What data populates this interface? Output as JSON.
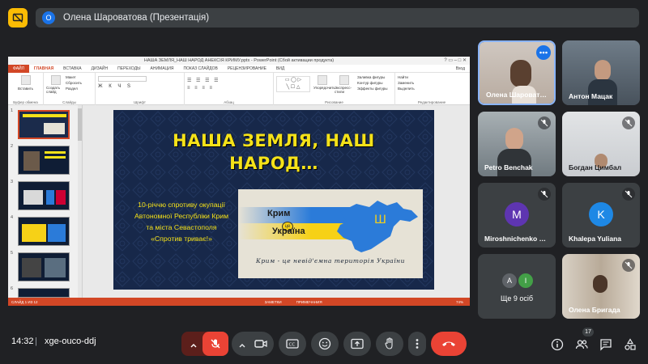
{
  "topbar": {
    "presenter_avatar": "O",
    "presenter_label": "Олена Шароватова (Презентація)"
  },
  "ppt": {
    "window_title": "НАША ЗЕМЛЯ_НАШ НАРОД АНЕКСІЯ КРИМУ.pptx - PowerPoint (Сбой активации продукта)",
    "menu": [
      "ФАЙЛ",
      "ГЛАВНАЯ",
      "ВСТАВКА",
      "ДИЗАЙН",
      "ПЕРЕХОДЫ",
      "АНИМАЦИЯ",
      "ПОКАЗ СЛАЙДОВ",
      "РЕЦЕНЗИРОВАНИЕ",
      "ВИД"
    ],
    "signin": "Вход",
    "ribbon": {
      "clipboard": {
        "name": "Буфер обмена",
        "paste": "Вставить"
      },
      "slides": {
        "name": "Слайды",
        "new_slide": "Создать слайд",
        "layout": "Макет",
        "reset": "Сбросить",
        "section": "Раздел"
      },
      "font": {
        "name": "Шрифт"
      },
      "paragraph": {
        "name": "Абзац"
      },
      "drawing": {
        "name": "Рисование",
        "arrange": "Упорядочить",
        "quick_styles": "Экспресс-стили",
        "fill": "Заливка фигуры",
        "outline": "Контур фигуры",
        "effects": "Эффекты фигуры"
      },
      "editing": {
        "name": "Редактирование",
        "find": "Найти",
        "replace": "Заменить",
        "select": "Выделить"
      }
    },
    "thumb_numbers": [
      "1",
      "2",
      "3",
      "4",
      "5",
      "6"
    ],
    "slide": {
      "title_line1": "НАША ЗЕМЛЯ, НАШ",
      "title_line2": "НАРОД…",
      "body": "10-річчю спротиву окупації Автономної Республіки Крим та міста Севастополя «Спротив триває!»",
      "card_word1": "Крим",
      "card_word2": "це",
      "card_word3": "Україна",
      "card_caption": "Крим - це невід'ємна територія України"
    },
    "status": {
      "slide_info": "СЛАЙД 1 ИЗ 12",
      "notes": "ЗАМЕТКИ",
      "comments": "ПРИМЕЧАНИЯ",
      "zoom": "74%"
    }
  },
  "participants": [
    {
      "name": "Олена Шароватова",
      "short": "Олена Шароват…",
      "muted": false,
      "video": true
    },
    {
      "name": "Антон Мацак",
      "muted": false,
      "video": true
    },
    {
      "name": "Petro Benchak",
      "muted": true,
      "video": true
    },
    {
      "name": "Богдан Цимбал",
      "muted": true,
      "video": true
    },
    {
      "name": "Miroshnichenko …",
      "initial": "M",
      "muted": true,
      "video": false,
      "color": "#5e35b1"
    },
    {
      "name": "Khalepa Yuliana",
      "initial": "K",
      "muted": true,
      "video": false,
      "color": "#1e88e5"
    },
    {
      "name": "Ще 9 осіб",
      "initials": [
        "A",
        "I"
      ],
      "video": false
    },
    {
      "name": "Олена Бригада",
      "muted": true,
      "video": true
    }
  ],
  "bottom": {
    "time": "14:32",
    "separator": "|",
    "meeting_code": "xge-ouco-ddj",
    "people_count": "17"
  },
  "colors": {
    "accent_red": "#ea4335",
    "ppt_orange": "#d24726",
    "slide_bg": "#17284a",
    "slide_yellow": "#f5e219",
    "ukraine_blue": "#2b7bd9",
    "ukraine_yellow": "#f6d117"
  }
}
